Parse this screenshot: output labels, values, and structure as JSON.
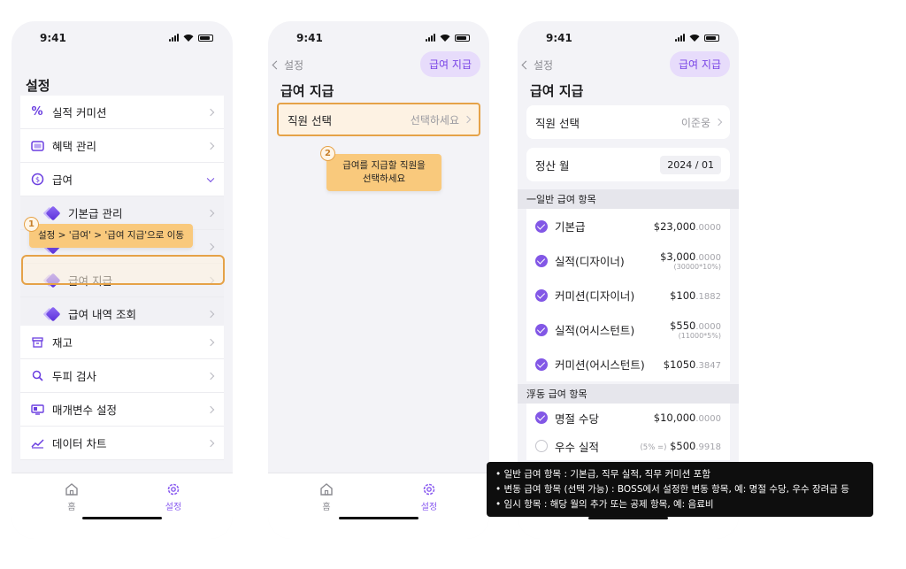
{
  "status_time": "9:41",
  "screen1": {
    "title": "설정",
    "items": [
      {
        "label": "실적 커미션",
        "icon": "percent-icon"
      },
      {
        "label": "혜택 관리",
        "icon": "card-icon"
      },
      {
        "label": "급여",
        "icon": "salary-icon"
      },
      {
        "label": "기본급 관리",
        "icon": "diamond-icon"
      },
      {
        "label": "",
        "icon": "diamond-icon"
      },
      {
        "label": "급여 지급",
        "icon": "diamond-icon"
      },
      {
        "label": "급여 내역 조회",
        "icon": "diamond-icon"
      },
      {
        "label": "재고",
        "icon": "box-icon"
      },
      {
        "label": "두피 검사",
        "icon": "magnifier-icon"
      },
      {
        "label": "매개변수 설정",
        "icon": "monitor-icon"
      },
      {
        "label": "데이터 차트",
        "icon": "chart-icon"
      }
    ],
    "tooltip": "설정 > '급여' > '급여 지급'으로 이동",
    "step": "1"
  },
  "tabs": {
    "home": "홈",
    "settings": "설정"
  },
  "screen2": {
    "back": "설정",
    "action": "급여 지급",
    "title": "급여 지급",
    "employee_label": "직원 선택",
    "employee_placeholder": "선택하세요",
    "tooltip_line1": "급여를 지급할 직원을",
    "tooltip_line2": "선택하세요",
    "step": "2"
  },
  "screen3": {
    "back": "설정",
    "action": "급여 지급",
    "title": "급여 지급",
    "employee_label": "직원 선택",
    "employee_value": "이준웅",
    "month_label": "정산 월",
    "month_value": "2024 / 01",
    "general_header": "一일반 급여 항목",
    "general_items": [
      {
        "name": "기본급",
        "amount": "$23,000",
        "dec": ".0000",
        "note": ""
      },
      {
        "name": "실적(디자이너)",
        "amount": "$3,000",
        "dec": ".0000",
        "note": "(30000*10%)"
      },
      {
        "name": "커미션(디자이너)",
        "amount": "$100",
        "dec": ".1882",
        "note": ""
      },
      {
        "name": "실적(어시스턴트)",
        "amount": "$550",
        "dec": ".0000",
        "note": "(11000*5%)"
      },
      {
        "name": "커미션(어시스턴트)",
        "amount": "$1050",
        "dec": ".3847",
        "note": ""
      }
    ],
    "variable_header": "浮동 급여 항목",
    "variable_items": [
      {
        "name": "명절 수당",
        "amount": "$10,000",
        "dec": ".0000",
        "pre": "",
        "checked": true
      },
      {
        "name": "우수 실적",
        "amount": "$500",
        "dec": ".9918",
        "pre": "(5% =)",
        "checked": false
      }
    ]
  },
  "info_box": {
    "line1": "일반 급여 항목 : 기본급, 직무 실적, 직무 커미션 포함",
    "line2": "변동 급여 항목 (선택 가능) : BOSS에서 설정한 변동 항목, 예: 명절 수당, 우수 장려금 등",
    "line3": "임시 항목 : 해당 월의 추가 또는 공제 항목, 예: 음료비"
  },
  "accent_color": "#8257e6",
  "highlight_color": "#e5a248"
}
